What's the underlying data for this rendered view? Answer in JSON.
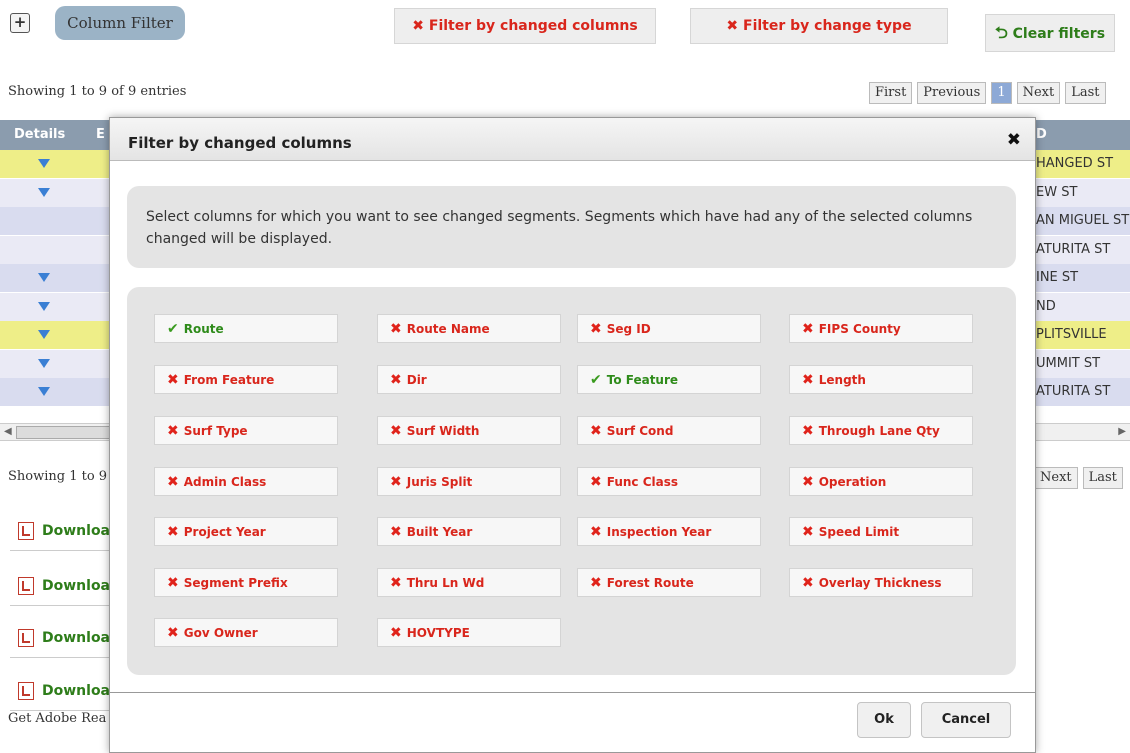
{
  "toolbar": {
    "expand_symbol": "+",
    "column_filter_label": "Column Filter",
    "filter_changed_columns_label": "Filter by changed columns",
    "filter_change_type_label": "Filter by change type",
    "clear_filters_label": "Clear filters"
  },
  "info": {
    "showing_top": "Showing 1 to 9 of 9 entries",
    "showing_bottom": "Showing 1 to 9"
  },
  "pagination": {
    "first": "First",
    "previous": "Previous",
    "page": "1",
    "next": "Next",
    "last": "Last"
  },
  "table": {
    "headers": [
      "Details",
      "E",
      "D"
    ],
    "rows": [
      {
        "street": "HANGED ST",
        "expand": true,
        "style": "yellow"
      },
      {
        "street": "EW ST",
        "expand": true,
        "style": "even"
      },
      {
        "street": "AN MIGUEL ST",
        "expand": false,
        "style": "odd"
      },
      {
        "street": "ATURITA ST",
        "expand": false,
        "style": "even"
      },
      {
        "street": "INE ST",
        "expand": true,
        "style": "odd"
      },
      {
        "street": "ND",
        "expand": true,
        "style": "even"
      },
      {
        "street": "PLITSVILLE",
        "expand": true,
        "style": "yellow"
      },
      {
        "street": "UMMIT ST",
        "expand": true,
        "style": "even"
      },
      {
        "street": "ATURITA ST",
        "expand": true,
        "style": "odd"
      }
    ]
  },
  "downloads": [
    "Downloa",
    "Downloa",
    "Downloa",
    "Downloa"
  ],
  "adobe_text": "Get Adobe Rea",
  "modal": {
    "title": "Filter by changed columns",
    "close_symbol": "✖",
    "description": "Select columns for which you want to see changed segments. Segments which have had any of the selected columns changed will be displayed.",
    "options": [
      {
        "label": "Route",
        "checked": true
      },
      {
        "label": "Route Name",
        "checked": false
      },
      {
        "label": "Seg ID",
        "checked": false
      },
      {
        "label": "FIPS County",
        "checked": false
      },
      {
        "label": "From Feature",
        "checked": false
      },
      {
        "label": "Dir",
        "checked": false
      },
      {
        "label": "To Feature",
        "checked": true
      },
      {
        "label": "Length",
        "checked": false
      },
      {
        "label": "Surf Type",
        "checked": false
      },
      {
        "label": "Surf Width",
        "checked": false
      },
      {
        "label": "Surf Cond",
        "checked": false
      },
      {
        "label": "Through Lane Qty",
        "checked": false
      },
      {
        "label": "Admin Class",
        "checked": false
      },
      {
        "label": "Juris Split",
        "checked": false
      },
      {
        "label": "Func Class",
        "checked": false
      },
      {
        "label": "Operation",
        "checked": false
      },
      {
        "label": "Project Year",
        "checked": false
      },
      {
        "label": "Built Year",
        "checked": false
      },
      {
        "label": "Inspection Year",
        "checked": false
      },
      {
        "label": "Speed Limit",
        "checked": false
      },
      {
        "label": "Segment Prefix",
        "checked": false
      },
      {
        "label": "Thru Ln Wd",
        "checked": false
      },
      {
        "label": "Forest Route",
        "checked": false
      },
      {
        "label": "Overlay Thickness",
        "checked": false
      },
      {
        "label": "Gov Owner",
        "checked": false
      },
      {
        "label": "HOVTYPE",
        "checked": false
      }
    ],
    "ok_label": "Ok",
    "cancel_label": "Cancel"
  },
  "colors": {
    "uncheck_red": "#d9261c",
    "check_green": "#2e8b1a",
    "header_bg": "#8b9cae",
    "column_filter_bg": "#9bb3c6"
  }
}
